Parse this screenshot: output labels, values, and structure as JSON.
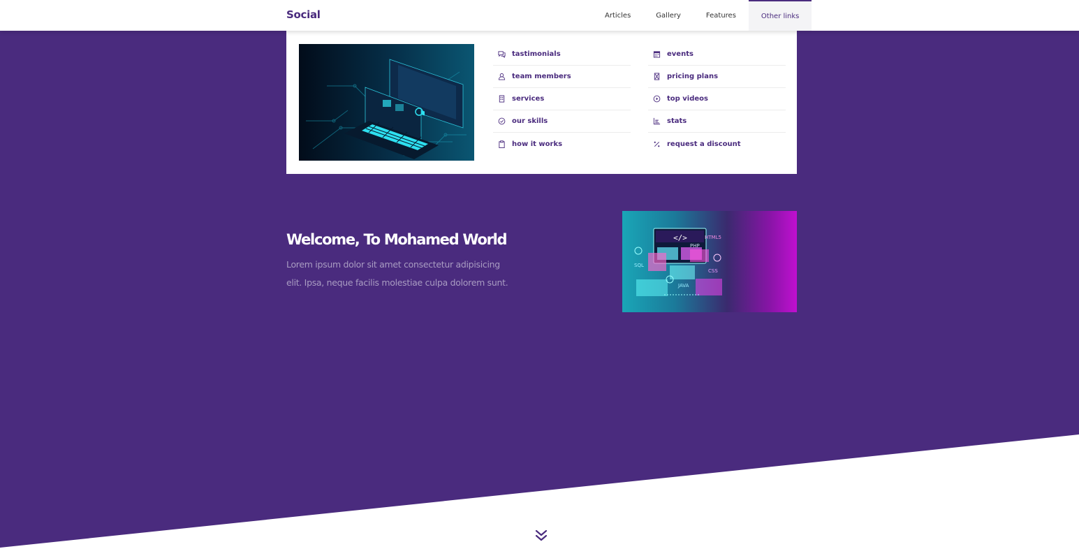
{
  "header": {
    "logo": "Social",
    "nav": [
      {
        "label": "Articles"
      },
      {
        "label": "Gallery"
      },
      {
        "label": "Features"
      },
      {
        "label": "Other links"
      }
    ]
  },
  "mega_menu": {
    "column1": [
      {
        "label": "tastimonials",
        "icon": "chat-icon"
      },
      {
        "label": "team members",
        "icon": "user-icon"
      },
      {
        "label": "services",
        "icon": "building-icon"
      },
      {
        "label": "our skills",
        "icon": "check-circle-icon"
      },
      {
        "label": "how it works",
        "icon": "clipboard-icon"
      }
    ],
    "column2": [
      {
        "label": "events",
        "icon": "calendar-icon"
      },
      {
        "label": "pricing plans",
        "icon": "hourglass-icon"
      },
      {
        "label": "top videos",
        "icon": "play-circle-icon"
      },
      {
        "label": "stats",
        "icon": "bar-chart-icon"
      },
      {
        "label": "request a discount",
        "icon": "percent-icon"
      }
    ]
  },
  "hero": {
    "title": "Welcome, To Mohamed World",
    "text": "Lorem ipsum dolor sit amet consectetur adipisicing elit. Ipsa, neque facilis molestiae culpa dolorem sunt.",
    "image_labels": [
      "</>",
      "HTML5",
      "PHP",
      "SQL",
      "CSS",
      "JAVA"
    ]
  },
  "colors": {
    "primary": "#4a2b7e",
    "text_muted": "#a99cc2"
  }
}
